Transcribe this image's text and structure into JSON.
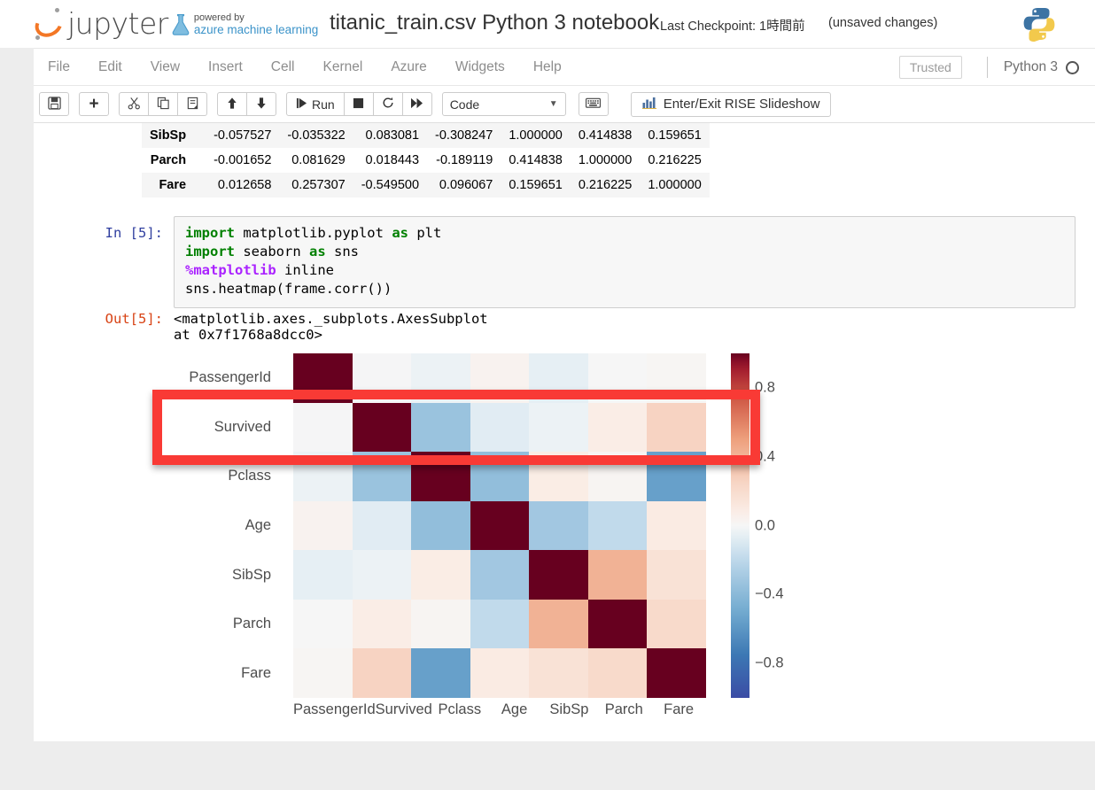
{
  "header": {
    "brand": "jupyter",
    "azure_line1": "powered by",
    "azure_line2": "azure machine learning",
    "notebook_title": "titanic_train.csv Python 3 notebook",
    "checkpoint": "Last Checkpoint: 1時間前",
    "unsaved": "(unsaved changes)",
    "python_logo_icon": "python-logo-icon"
  },
  "menubar": {
    "items": [
      {
        "label": "File"
      },
      {
        "label": "Edit"
      },
      {
        "label": "View"
      },
      {
        "label": "Insert"
      },
      {
        "label": "Cell"
      },
      {
        "label": "Kernel"
      },
      {
        "label": "Azure"
      },
      {
        "label": "Widgets"
      },
      {
        "label": "Help"
      }
    ],
    "trusted": "Trusted",
    "kernel": "Python 3",
    "kernel_idle_icon": "circle-idle-icon"
  },
  "toolbar": {
    "save_icon": "save-floppy-icon",
    "insert_icon": "plus-icon",
    "cut_icon": "scissors-icon",
    "copy_icon": "copy-icon",
    "paste_icon": "paste-icon",
    "move_up_icon": "arrow-up-icon",
    "move_down_icon": "arrow-down-icon",
    "run_label": "Run",
    "run_icon": "run-icon",
    "stop_icon": "stop-square-icon",
    "restart_icon": "restart-circle-icon",
    "restart_run_all_icon": "fast-forward-icon",
    "cell_type": "Code",
    "cell_type_caret": "chevron-down-icon",
    "keyboard_icon": "keyboard-icon",
    "rise_label": "Enter/Exit RISE Slideshow",
    "rise_icon": "bar-chart-icon"
  },
  "notebook": {
    "corr_table": {
      "rows": [
        {
          "label": "SibSp",
          "values": [
            "-0.057527",
            "-0.035322",
            "0.083081",
            "-0.308247",
            "1.000000",
            "0.414838",
            "0.159651"
          ]
        },
        {
          "label": "Parch",
          "values": [
            "-0.001652",
            "0.081629",
            "0.018443",
            "-0.189119",
            "0.414838",
            "1.000000",
            "0.216225"
          ]
        },
        {
          "label": "Fare",
          "values": [
            "0.012658",
            "0.257307",
            "-0.549500",
            "0.096067",
            "0.159651",
            "0.216225",
            "1.000000"
          ]
        }
      ]
    },
    "in_prompt": "In [5]:",
    "code_lines": [
      {
        "parts": [
          {
            "t": "import",
            "c": "kw"
          },
          {
            "t": " matplotlib.pyplot ",
            "c": ""
          },
          {
            "t": "as",
            "c": "kw"
          },
          {
            "t": " plt",
            "c": ""
          }
        ]
      },
      {
        "parts": [
          {
            "t": "import",
            "c": "kw"
          },
          {
            "t": " seaborn ",
            "c": ""
          },
          {
            "t": "as",
            "c": "kw"
          },
          {
            "t": " sns",
            "c": ""
          }
        ]
      },
      {
        "parts": [
          {
            "t": "%matplotlib",
            "c": "mag"
          },
          {
            "t": " inline",
            "c": ""
          }
        ]
      },
      {
        "parts": [
          {
            "t": "sns.heatmap(frame.corr())",
            "c": ""
          }
        ]
      }
    ],
    "out_prompt": "Out[5]:",
    "out_text": "<matplotlib.axes._subplots.AxesSubplot at 0x7f1768a8dcc0>"
  },
  "annotation": {
    "name": "red-highlight-rectangle",
    "color": "#f93a35",
    "targets_row": "Survived"
  },
  "chart_data": {
    "type": "heatmap",
    "title": "",
    "xlabel": "",
    "ylabel": "",
    "colormap": "coolwarm-diverging",
    "colorbar": {
      "ticks": [
        "0.8",
        "0.4",
        "0.0",
        "−0.4",
        "−0.8"
      ],
      "vmin": -1.0,
      "vmax": 1.0,
      "position": "right"
    },
    "x_categories": [
      "PassengerId",
      "Survived",
      "Pclass",
      "Age",
      "SibSp",
      "Parch",
      "Fare"
    ],
    "y_categories": [
      "PassengerId",
      "Survived",
      "Pclass",
      "Age",
      "SibSp",
      "Parch",
      "Fare"
    ],
    "values": [
      [
        1.0,
        -0.005007,
        -0.035144,
        0.036847,
        -0.057527,
        -0.001652,
        0.012658
      ],
      [
        -0.005007,
        1.0,
        -0.338481,
        -0.077221,
        -0.035322,
        0.081629,
        0.257307
      ],
      [
        -0.035144,
        -0.338481,
        1.0,
        -0.369226,
        0.083081,
        0.018443,
        -0.5495
      ],
      [
        0.036847,
        -0.077221,
        -0.369226,
        1.0,
        -0.308247,
        -0.189119,
        0.096067
      ],
      [
        -0.057527,
        -0.035322,
        0.083081,
        -0.308247,
        1.0,
        0.414838,
        0.159651
      ],
      [
        -0.001652,
        0.081629,
        0.018443,
        -0.189119,
        0.414838,
        1.0,
        0.216225
      ],
      [
        0.012658,
        0.257307,
        -0.5495,
        0.096067,
        0.159651,
        0.216225,
        1.0
      ]
    ]
  }
}
